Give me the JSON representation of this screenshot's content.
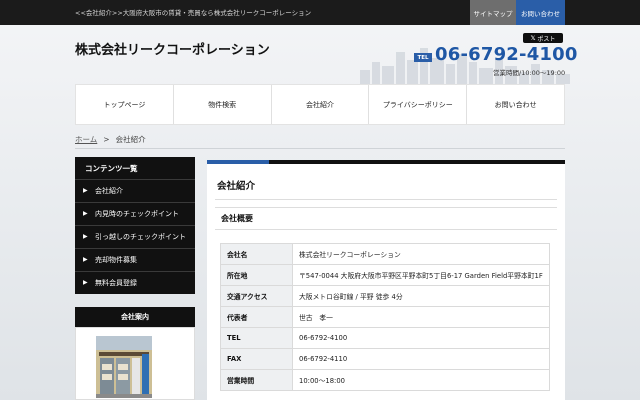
{
  "topbar": {
    "description": "<<会社紹介>>大阪府大阪市の賃貸・売買なら株式会社リークコーポレーション",
    "sitemap_label": "サイトマップ",
    "contact_label": "お問い合わせ"
  },
  "header": {
    "company_name": "株式会社リークコーポレーション",
    "post_button_label": "ポスト",
    "tel_badge": "TEL",
    "tel_number": "06-6792-4100",
    "business_hours": "営業時間/10:00～19:00"
  },
  "nav": {
    "items": [
      {
        "label": "トップページ"
      },
      {
        "label": "物件検索"
      },
      {
        "label": "会社紹介"
      },
      {
        "label": "プライバシーポリシー"
      },
      {
        "label": "お問い合わせ"
      }
    ]
  },
  "breadcrumb": {
    "home": "ホーム",
    "separator": ">",
    "current": "会社紹介"
  },
  "sidebar": {
    "contents_title": "コンテンツ一覧",
    "items": [
      {
        "label": "会社紹介"
      },
      {
        "label": "内見時のチェックポイント"
      },
      {
        "label": "引っ越しのチェックポイント"
      },
      {
        "label": "売却物件募集"
      },
      {
        "label": "無料会員登録"
      }
    ],
    "company_guide_title": "会社案内"
  },
  "main": {
    "page_title": "会社紹介",
    "section_title": "会社概要",
    "rows": [
      {
        "key": "会社名",
        "value": "株式会社リークコーポレーション"
      },
      {
        "key": "所在地",
        "value": "〒547-0044 大阪府大阪市平野区平野本町5丁目6-17 Garden Field平野本町1F"
      },
      {
        "key": "交通アクセス",
        "value": "大阪メトロ谷町線 / 平野 徒歩 4分"
      },
      {
        "key": "代表者",
        "value": "世古　孝一"
      },
      {
        "key": "TEL",
        "value": "06-6792-4100"
      },
      {
        "key": "FAX",
        "value": "06-6792-4110"
      },
      {
        "key": "営業時間",
        "value": "10:00～18:00"
      }
    ]
  },
  "colors": {
    "accent_blue": "#2a5ea8",
    "topbar_black": "#1b1b1b",
    "tel_blue": "#1f57a5"
  },
  "icons": {
    "x_logo": "x-logo-icon",
    "arrow": "chevron-right-icon"
  }
}
